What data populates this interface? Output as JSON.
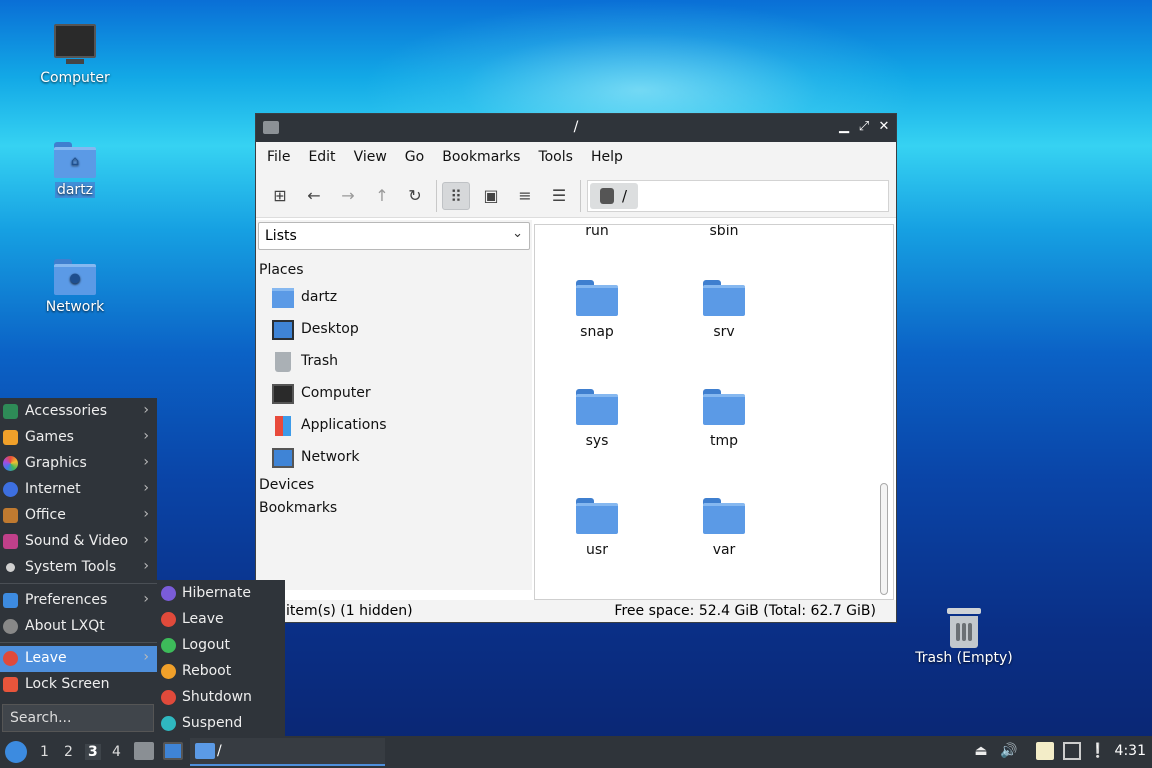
{
  "desktop": {
    "icons": [
      {
        "label": "Computer"
      },
      {
        "label": "dartz"
      },
      {
        "label": "Network"
      },
      {
        "label": "Trash (Empty)"
      }
    ]
  },
  "window": {
    "title": "/",
    "menu": [
      "File",
      "Edit",
      "View",
      "Go",
      "Bookmarks",
      "Tools",
      "Help"
    ],
    "path": "/",
    "side_mode": "Lists",
    "sections": {
      "places": "Places",
      "devices": "Devices",
      "bookmarks": "Bookmarks"
    },
    "places": [
      "dartz",
      "Desktop",
      "Trash",
      "Computer",
      "Applications",
      "Network"
    ],
    "partial_top": [
      "run",
      "sbin"
    ],
    "folders": [
      "snap",
      "srv",
      "sys",
      "tmp",
      "usr",
      "var"
    ],
    "status_left": "item(s) (1 hidden)",
    "status_right": "Free space: 52.4 GiB (Total: 62.7 GiB)"
  },
  "start_menu": {
    "items": [
      "Accessories",
      "Games",
      "Graphics",
      "Internet",
      "Office",
      "Sound & Video",
      "System Tools"
    ],
    "items2": [
      "Preferences",
      "About LXQt"
    ],
    "leave": "Leave",
    "lock": "Lock Screen",
    "search_placeholder": "Search...",
    "leave_sub": [
      "Hibernate",
      "Leave",
      "Logout",
      "Reboot",
      "Shutdown",
      "Suspend"
    ]
  },
  "taskbar": {
    "desktops": [
      "1",
      "2",
      "3",
      "4"
    ],
    "current_desktop": "3",
    "task_title": "/",
    "clock": "4:31"
  },
  "colors": {
    "accent": "#4e8fdc",
    "panel": "#2f343a",
    "folder": "#5b9ae6"
  }
}
